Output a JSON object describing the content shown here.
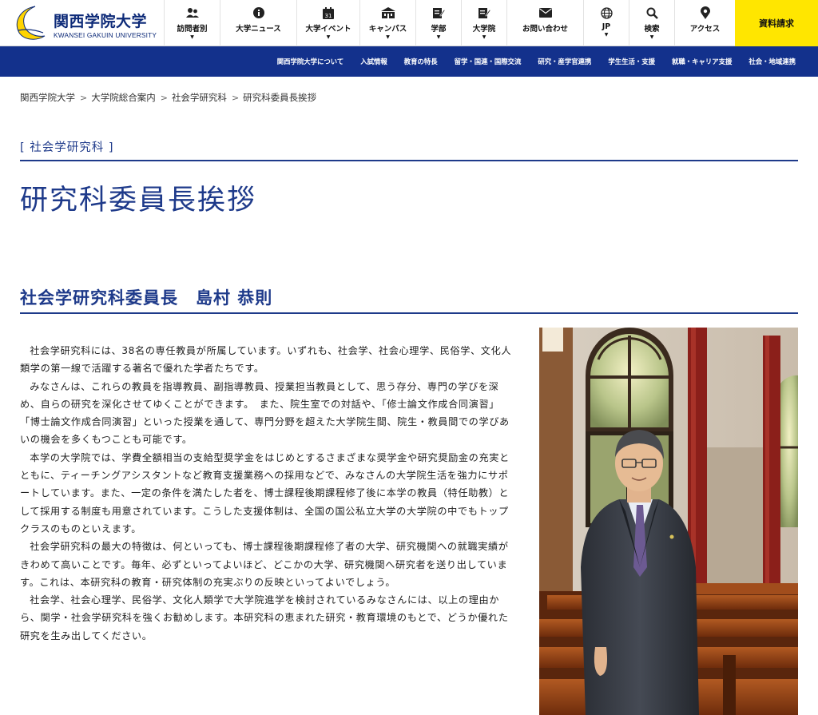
{
  "header": {
    "logo_jp": "関西学院大学",
    "logo_en": "KWANSEI GAKUIN UNIVERSITY",
    "nav": [
      {
        "label": "訪問者別",
        "icon": "visitors-icon",
        "has_dropdown": true
      },
      {
        "label": "大学ニュース",
        "icon": "info-icon",
        "has_dropdown": false
      },
      {
        "label": "大学イベント",
        "icon": "calendar-icon",
        "has_dropdown": true
      },
      {
        "label": "キャンパス",
        "icon": "campus-building-icon",
        "has_dropdown": true
      },
      {
        "label": "学部",
        "icon": "edit-note-icon",
        "has_dropdown": true
      },
      {
        "label": "大学院",
        "icon": "edit-note-icon",
        "has_dropdown": true
      },
      {
        "label": "お問い合わせ",
        "icon": "envelope-icon",
        "has_dropdown": false
      },
      {
        "label": "JP",
        "icon": "globe-icon",
        "has_dropdown": true
      },
      {
        "label": "検索",
        "icon": "search-icon",
        "has_dropdown": true
      },
      {
        "label": "アクセス",
        "icon": "map-pin-icon",
        "has_dropdown": false
      }
    ],
    "request_button": "資料請求"
  },
  "main_nav": [
    "関西学院大学について",
    "入試情報",
    "教育の特長",
    "留学・国連・国際交流",
    "研究・産学官連携",
    "学生生活・支援",
    "就職・キャリア支援",
    "社会・地域連携"
  ],
  "breadcrumb": [
    "関西学院大学",
    "大学院総合案内",
    "社会学研究科",
    "研究科委員長挨拶"
  ],
  "section_tag": "[ 社会学研究科 ]",
  "page_title": "研究科委員長挨拶",
  "subheading": "社会学研究科委員長　島村 恭則",
  "paragraphs": [
    "社会学研究科には、38名の専任教員が所属しています。いずれも、社会学、社会心理学、民俗学、文化人類学の第一線で活躍する著名で優れた学者たちです。",
    "みなさんは、これらの教員を指導教員、副指導教員、授業担当教員として、思う存分、専門の学びを深め、自らの研究を深化させてゆくことができます。　また、院生室での対話や、「修士論文作成合同演習」「博士論文作成合同演習」といった授業を通して、専門分野を超えた大学院生間、院生・教員間での学びあいの機会を多くもつことも可能です。",
    "本学の大学院では、学費全額相当の支給型奨学金をはじめとするさまざまな奨学金や研究奨励金の充実とともに、ティーチングアシスタントなど教育支援業務への採用などで、みなさんの大学院生活を強力にサポートしています。また、一定の条件を満たした者を、博士課程後期課程修了後に本学の教員（特任助教）として採用する制度も用意されています。こうした支援体制は、全国の国公私立大学の大学院の中でもトップクラスのものといえます。",
    "社会学研究科の最大の特徴は、何といっても、博士課程後期課程修了者の大学、研究機関への就職実績がきわめて高いことです。毎年、必ずといってよいほど、どこかの大学、研究機関へ研究者を送り出しています。これは、本研究科の教育・研究体制の充実ぶりの反映といってよいでしょう。",
    "社会学、社会心理学、民俗学、文化人類学で大学院進学を検討されているみなさんには、以上の理由から、関学・社会学研究科を強くお勧めします。本研究科の恵まれた研究・教育環境のもとで、どうか優れた研究を生み出してください。"
  ],
  "colors": {
    "brand_blue": "#13318c",
    "heading_blue": "#1e3a8a",
    "request_yellow": "#ffe600"
  }
}
